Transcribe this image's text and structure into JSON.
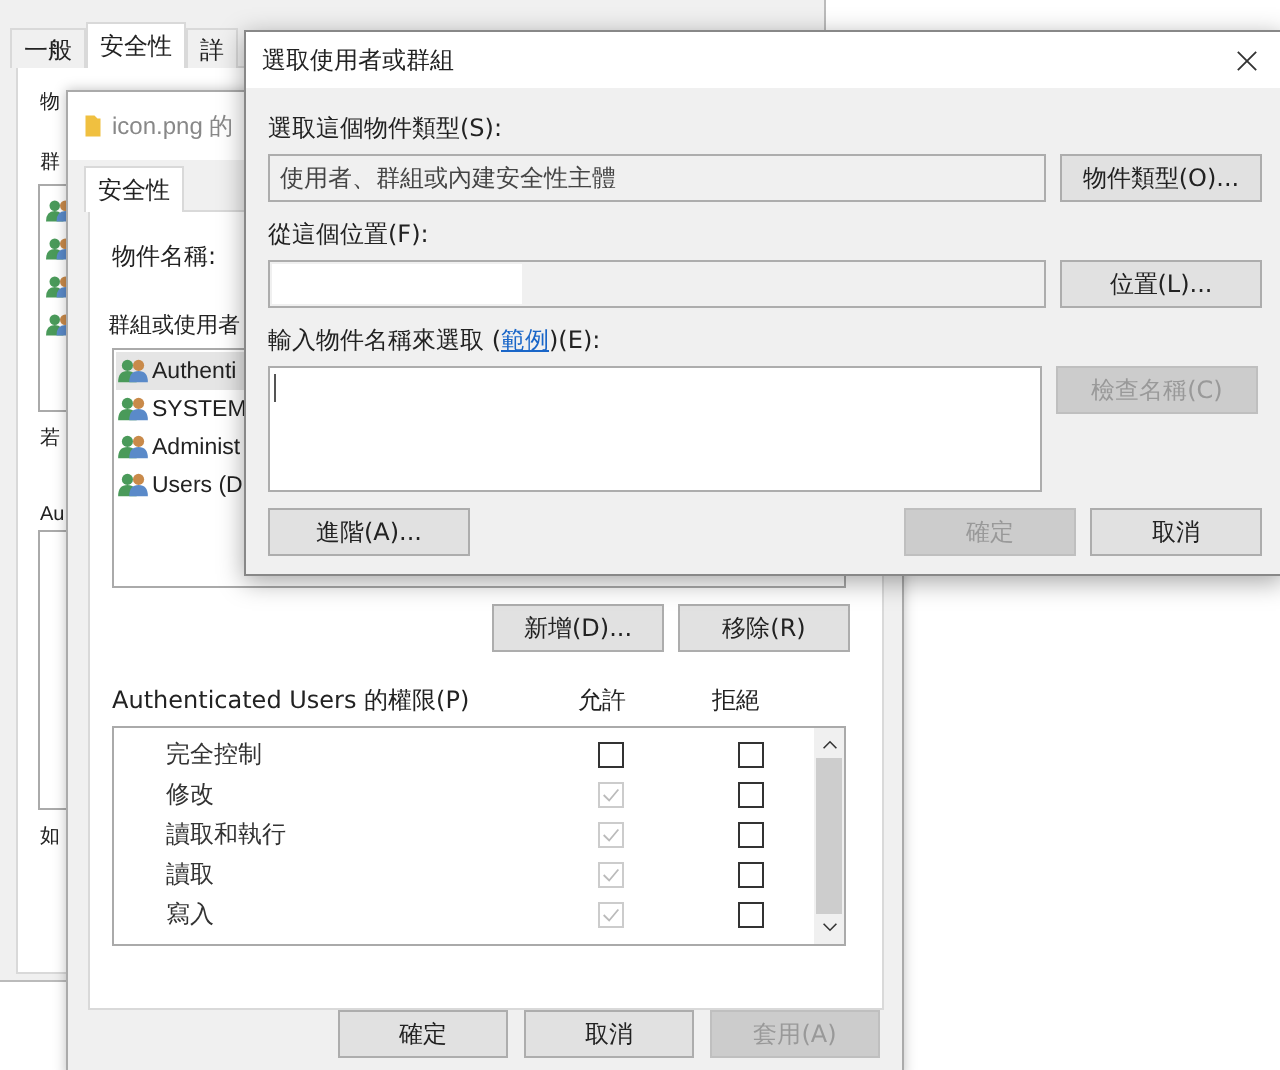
{
  "back_window": {
    "tabs": [
      {
        "label": "一般",
        "selected": false
      },
      {
        "label": "安全性",
        "selected": true
      },
      {
        "label": "詳",
        "selected": false
      }
    ],
    "object_label": "物",
    "group_label": "群",
    "note": "若",
    "permissions_label": "Au",
    "footer_note": "如"
  },
  "properties_window": {
    "title": "icon.png 的",
    "tabs": [
      {
        "label": "安全性",
        "selected": true
      }
    ],
    "object_name_label": "物件名稱:",
    "group_label": "群組或使用者",
    "principals": [
      {
        "name": "Authenti",
        "selected": true
      },
      {
        "name": "SYSTEM",
        "selected": false
      },
      {
        "name": "Administ",
        "selected": false
      },
      {
        "name": "Users (D",
        "selected": false
      }
    ],
    "add_button": "新增(D)...",
    "remove_button": "移除(R)",
    "permissions": {
      "title": "Authenticated Users 的權限(P)",
      "columns": [
        "允許",
        "拒絕"
      ],
      "rows": [
        {
          "name": "完全控制",
          "allow": {
            "checked": false,
            "disabled": false
          },
          "deny": {
            "checked": false,
            "disabled": false
          }
        },
        {
          "name": "修改",
          "allow": {
            "checked": true,
            "disabled": true
          },
          "deny": {
            "checked": false,
            "disabled": false
          }
        },
        {
          "name": "讀取和執行",
          "allow": {
            "checked": true,
            "disabled": true
          },
          "deny": {
            "checked": false,
            "disabled": false
          }
        },
        {
          "name": "讀取",
          "allow": {
            "checked": true,
            "disabled": true
          },
          "deny": {
            "checked": false,
            "disabled": false
          }
        },
        {
          "name": "寫入",
          "allow": {
            "checked": true,
            "disabled": true
          },
          "deny": {
            "checked": false,
            "disabled": false
          }
        }
      ]
    },
    "buttons": [
      {
        "label": "確定",
        "disabled": false
      },
      {
        "label": "取消",
        "disabled": false
      },
      {
        "label": "套用(A)",
        "disabled": true
      }
    ]
  },
  "select_dialog": {
    "title": "選取使用者或群組",
    "object_type_label": "選取這個物件類型(S):",
    "object_type_value": "使用者、群組或內建安全性主體",
    "object_types_button": "物件類型(O)...",
    "location_label": "從這個位置(F):",
    "locations_button": "位置(L)...",
    "names_label": {
      "before": "輸入物件名稱來選取 (",
      "link": "範例",
      "after": ")(E):"
    },
    "check_names_button": {
      "label": "檢查名稱(C)",
      "disabled": true
    },
    "advanced_button": "進階(A)...",
    "buttons": [
      {
        "label": "確定",
        "disabled": true
      },
      {
        "label": "取消",
        "disabled": false
      }
    ]
  }
}
